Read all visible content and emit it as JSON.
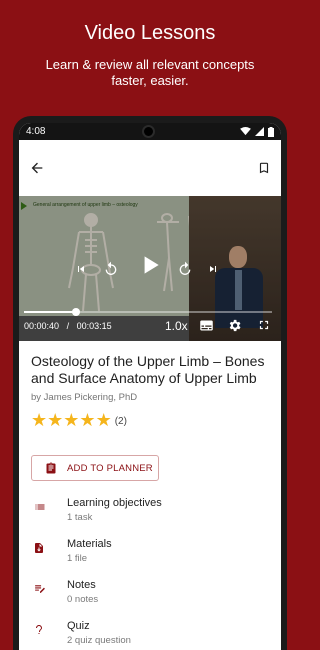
{
  "promo": {
    "title": "Video Lessons",
    "subtitle": "Learn & review all relevant concepts faster, easier."
  },
  "status_bar": {
    "time": "4:08"
  },
  "video": {
    "slide_title": "General arrangement of upper limb – osteology",
    "current_time": "00:00:40",
    "separator": "/",
    "duration": "00:03:15",
    "speed": "1.0x",
    "progress_fraction": 0.21
  },
  "lesson": {
    "title": "Osteology of the Upper Limb – Bones and Surface Anatomy of Upper Limb",
    "author": "by James Pickering, PhD",
    "rating_stars": 5,
    "rating_count": "(2)"
  },
  "planner_button": {
    "label": "ADD TO PLANNER"
  },
  "items": [
    {
      "title": "Learning objectives",
      "sub": "1 task",
      "icon": "list-icon"
    },
    {
      "title": "Materials",
      "sub": "1 file",
      "icon": "file-download-icon"
    },
    {
      "title": "Notes",
      "sub": "0 notes",
      "icon": "edit-notes-icon"
    },
    {
      "title": "Quiz",
      "sub": "2 quiz question",
      "icon": "question-icon"
    }
  ],
  "colors": {
    "brand": "#8b1014",
    "star": "#f5b51c"
  }
}
